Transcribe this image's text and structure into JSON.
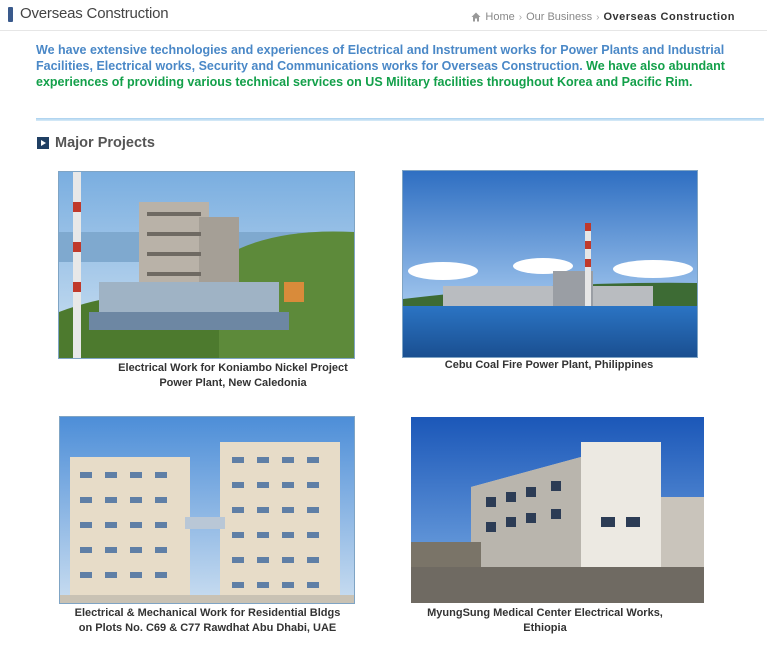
{
  "header": {
    "title": "Overseas Construction",
    "breadcrumb": {
      "home": "Home",
      "level2": "Our Business",
      "current": "Overseas Construction"
    }
  },
  "intro": {
    "blue_text": "We have extensive technologies and experiences of  Electrical and Instrument works for Power Plants and Industrial Facilities, Electrical works, Security and Communications works  for  Overseas Construction.",
    "green_text": " We have also abundant experiences of providing various technical services on US Military facilities throughout Korea and Pacific Rim."
  },
  "section": {
    "title": "Major Projects"
  },
  "projects": [
    {
      "caption_line1": "Electrical Work for Koniambo Nickel Project",
      "caption_line2": "Power Plant, New Caledonia"
    },
    {
      "caption_line1": "Cebu Coal Fire Power Plant, Philippines",
      "caption_line2": ""
    },
    {
      "caption_line1": "Electrical & Mechanical Work for Residential Bldgs",
      "caption_line2": "on Plots No. C69 & C77 Rawdhat Abu Dhabi, UAE"
    },
    {
      "caption_line1": "MyungSung Medical Center Electrical Works,",
      "caption_line2": "Ethiopia"
    }
  ],
  "colors": {
    "blue_text": "#4a88c7",
    "green_text": "#13a04a",
    "divider": "#a9d0ee"
  }
}
